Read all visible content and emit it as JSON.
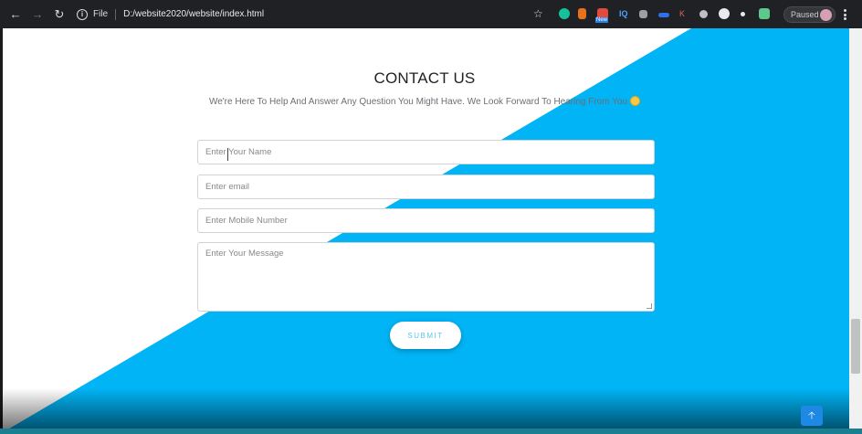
{
  "browser": {
    "url_scheme": "File",
    "url": "D:/website2020/website/index.html",
    "profile_status": "Paused",
    "extensions": [
      "grammarly-icon",
      "notes-icon",
      "new-badge-icon",
      "iq-icon",
      "tag-icon",
      "download-icon",
      "close-icon",
      "gear-icon",
      "history-icon",
      "dot-icon",
      "puzzle-icon"
    ],
    "extension_texts": {
      "iq": "IQ",
      "new": "New",
      "k": "K"
    }
  },
  "page": {
    "title": "CONTACT US",
    "subtitle": "We're Here To Help And Answer Any Question You Might Have. We Look Forward To Hearing From You",
    "form": {
      "name_placeholder": "Enter Your Name",
      "email_placeholder": "Enter email",
      "mobile_placeholder": "Enter Mobile Number",
      "message_placeholder": "Enter Your Message",
      "submit_label": "SUBMIT"
    }
  },
  "colors": {
    "accent": "#00b4f5",
    "chrome": "#202124",
    "page_bg": "#ffffff"
  }
}
